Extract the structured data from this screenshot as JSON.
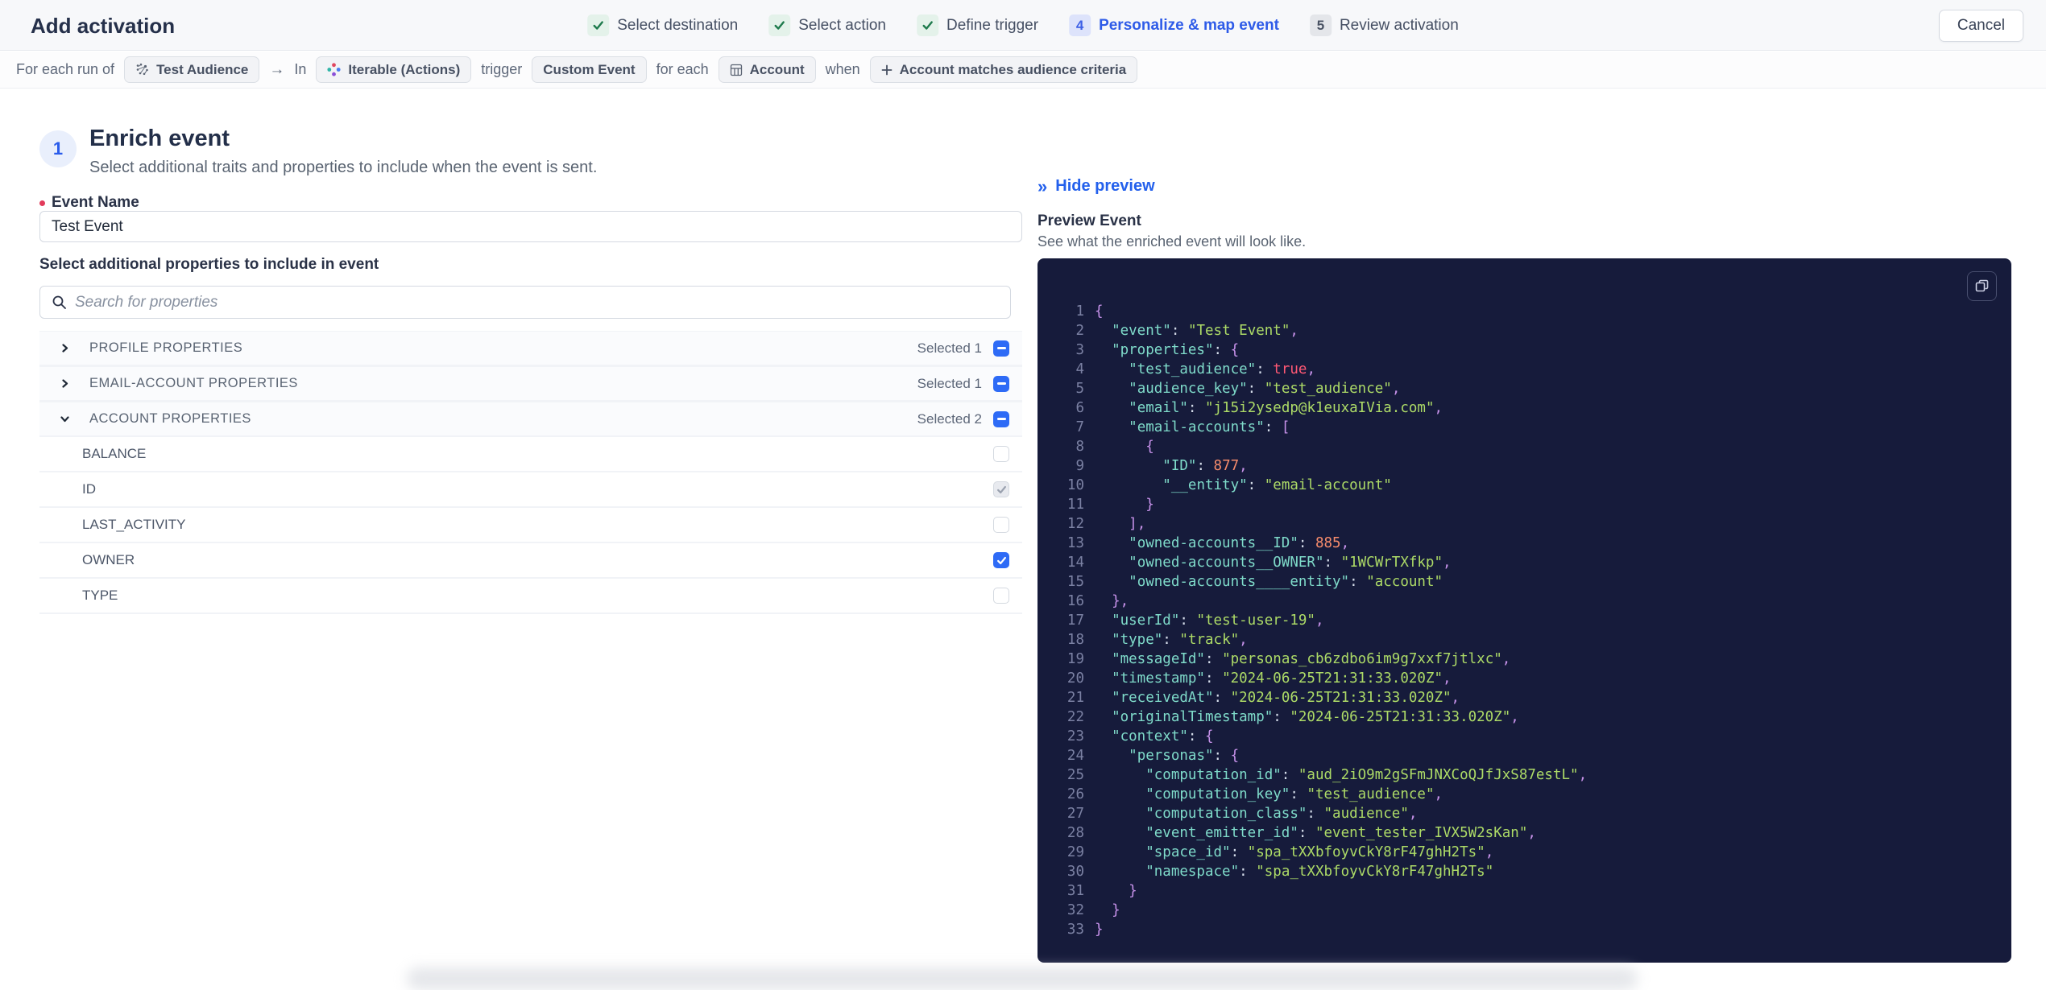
{
  "colors": {
    "accent_blue": "#2E5BE8",
    "checkbox_blue": "#2E6BF6",
    "success_green": "#1E7A4C",
    "link_blue": "#2360EC",
    "required_red": "#E23B5B",
    "code_bg": "#161B3B",
    "code_key": "#7FDBCA",
    "code_string": "#ADDB67",
    "code_number": "#F78C6C",
    "code_boolean": "#FF5874",
    "code_brace": "#C792EA"
  },
  "header": {
    "title": "Add activation",
    "cancel_label": "Cancel"
  },
  "stepper": {
    "steps": [
      {
        "label": "Select destination",
        "state": "done"
      },
      {
        "label": "Select action",
        "state": "done"
      },
      {
        "label": "Define trigger",
        "state": "done"
      },
      {
        "label": "Personalize & map event",
        "state": "active",
        "number": "4"
      },
      {
        "label": "Review activation",
        "state": "upcoming",
        "number": "5"
      }
    ]
  },
  "sentence": {
    "segments": [
      {
        "type": "text",
        "text": "For each run of"
      },
      {
        "type": "chip",
        "icon": "audience-icon",
        "label": "Test Audience"
      },
      {
        "type": "arrow",
        "text": "→"
      },
      {
        "type": "text",
        "text": "In"
      },
      {
        "type": "chip",
        "icon": "iterable-icon",
        "label": "Iterable (Actions)"
      },
      {
        "type": "text",
        "text": "trigger"
      },
      {
        "type": "chip",
        "label": "Custom Event"
      },
      {
        "type": "text",
        "text": "for each"
      },
      {
        "type": "chip",
        "icon": "table-icon",
        "label": "Account"
      },
      {
        "type": "text",
        "text": "when"
      },
      {
        "type": "chip",
        "icon": "plus-icon",
        "label": "Account matches audience criteria"
      }
    ]
  },
  "enrich": {
    "step_number": "1",
    "title": "Enrich event",
    "subtitle": "Select additional traits and properties to include when the event is sent.",
    "event_name_label": "Event Name",
    "event_name_value": "Test Event",
    "properties_label": "Select additional properties to include in event",
    "search_placeholder": "Search for properties",
    "groups": [
      {
        "label": "PROFILE PROPERTIES",
        "selected_text": "Selected 1",
        "expanded": false
      },
      {
        "label": "EMAIL-ACCOUNT PROPERTIES",
        "selected_text": "Selected 1",
        "expanded": false
      },
      {
        "label": "ACCOUNT PROPERTIES",
        "selected_text": "Selected 2",
        "expanded": true
      }
    ],
    "account_properties": [
      {
        "label": "BALANCE",
        "state": "unchecked"
      },
      {
        "label": "ID",
        "state": "checked-disabled"
      },
      {
        "label": "LAST_ACTIVITY",
        "state": "unchecked"
      },
      {
        "label": "OWNER",
        "state": "checked"
      },
      {
        "label": "TYPE",
        "state": "unchecked"
      }
    ]
  },
  "preview": {
    "hide_label": "Hide preview",
    "title": "Preview Event",
    "subtitle": "See what the enriched event will look like.",
    "code_lines": [
      "{",
      "  \"event\": \"Test Event\",",
      "  \"properties\": {",
      "    \"test_audience\": true,",
      "    \"audience_key\": \"test_audience\",",
      "    \"email\": \"j15i2ysedp@k1euxaIVia.com\",",
      "    \"email-accounts\": [",
      "      {",
      "        \"ID\": 877,",
      "        \"__entity\": \"email-account\"",
      "      }",
      "    ],",
      "    \"owned-accounts__ID\": 885,",
      "    \"owned-accounts__OWNER\": \"1WCWrTXfkp\",",
      "    \"owned-accounts____entity\": \"account\"",
      "  },",
      "  \"userId\": \"test-user-19\",",
      "  \"type\": \"track\",",
      "  \"messageId\": \"personas_cb6zdbo6im9g7xxf7jtlxc\",",
      "  \"timestamp\": \"2024-06-25T21:31:33.020Z\",",
      "  \"receivedAt\": \"2024-06-25T21:31:33.020Z\",",
      "  \"originalTimestamp\": \"2024-06-25T21:31:33.020Z\",",
      "  \"context\": {",
      "    \"personas\": {",
      "      \"computation_id\": \"aud_2iO9m2gSFmJNXCoQJfJxS87estL\",",
      "      \"computation_key\": \"test_audience\",",
      "      \"computation_class\": \"audience\",",
      "      \"event_emitter_id\": \"event_tester_IVX5W2sKan\",",
      "      \"space_id\": \"spa_tXXbfoyvCkY8rF47ghH2Ts\",",
      "      \"namespace\": \"spa_tXXbfoyvCkY8rF47ghH2Ts\"",
      "    }",
      "  }",
      "}"
    ]
  }
}
